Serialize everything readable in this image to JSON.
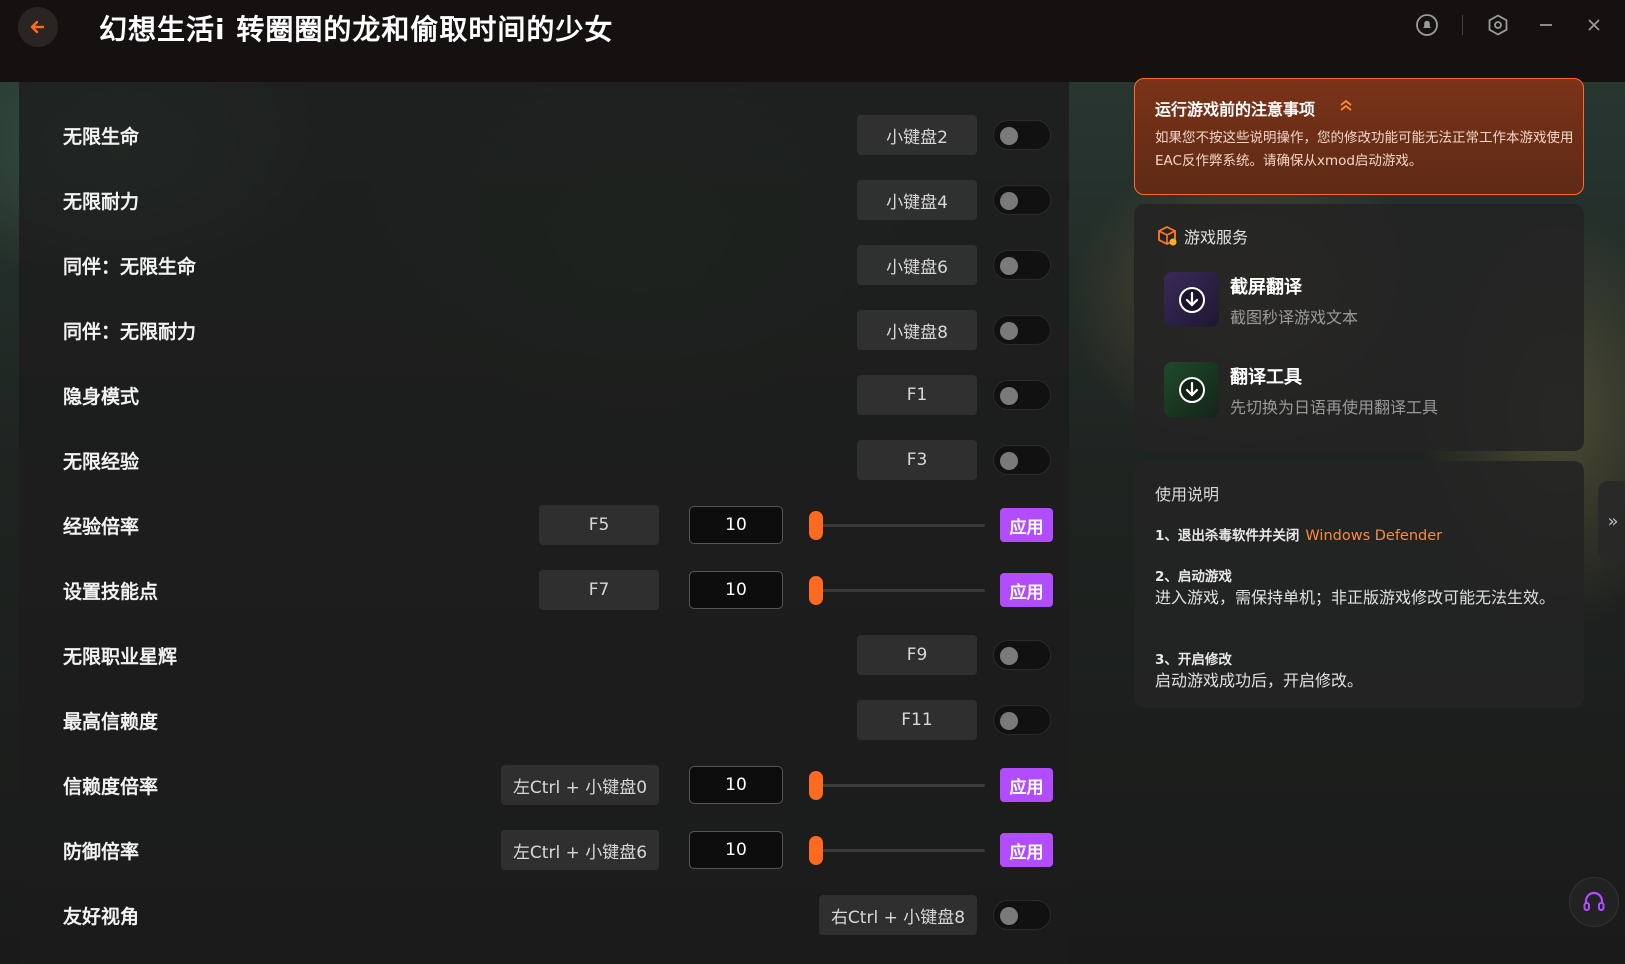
{
  "app": {
    "title": "幻想生活i 转圈圈的龙和偷取时间的少女"
  },
  "rows": [
    {
      "label": "无限生命",
      "key": "小键盘2",
      "type": "toggle"
    },
    {
      "label": "无限耐力",
      "key": "小键盘4",
      "type": "toggle"
    },
    {
      "label": "同伴：无限生命",
      "key": "小键盘6",
      "type": "toggle"
    },
    {
      "label": "同伴：无限耐力",
      "key": "小键盘8",
      "type": "toggle"
    },
    {
      "label": "隐身模式",
      "key": "F1",
      "type": "toggle"
    },
    {
      "label": "无限经验",
      "key": "F3",
      "type": "toggle"
    },
    {
      "label": "经验倍率",
      "key": "F5",
      "type": "slider",
      "value": "10",
      "apply": "应用"
    },
    {
      "label": "设置技能点",
      "key": "F7",
      "type": "slider",
      "value": "10",
      "apply": "应用"
    },
    {
      "label": "无限职业星辉",
      "key": "F9",
      "type": "toggle"
    },
    {
      "label": "最高信赖度",
      "key": "F11",
      "type": "toggle"
    },
    {
      "label": "信赖度倍率",
      "key": "左Ctrl + 小键盘0",
      "type": "slider",
      "value": "10",
      "apply": "应用"
    },
    {
      "label": "防御倍率",
      "key": "左Ctrl + 小键盘6",
      "type": "slider",
      "value": "10",
      "apply": "应用"
    },
    {
      "label": "友好视角",
      "key": "右Ctrl + 小键盘8",
      "type": "toggle"
    }
  ],
  "notice": {
    "title": "运行游戏前的注意事项",
    "text": "如果您不按这些说明操作，您的修改功能可能无法正常工作本游戏使用EAC反作弊系统。请确保从xmod启动游戏。"
  },
  "services": {
    "title": "游戏服务",
    "items": [
      {
        "title": "截屏翻译",
        "subtitle": "截图秒译游戏文本"
      },
      {
        "title": "翻译工具",
        "subtitle": "先切换为日语再使用翻译工具"
      }
    ]
  },
  "howto": {
    "title": "使用说明",
    "steps": [
      {
        "head": "1、退出杀毒软件并关闭",
        "link": "Windows Defender",
        "body": ""
      },
      {
        "head": "2、启动游戏",
        "body": "进入游戏，需保持单机；非正版游戏修改可能无法生效。"
      },
      {
        "head": "3、开启修改",
        "body": "启动游戏成功后，开启修改。"
      }
    ]
  },
  "colors": {
    "accent_orange": "#ff6a1f",
    "apply_purple": "#b14cff",
    "notice_border": "#ff6a2a"
  },
  "icons": {
    "back": "arrow-left-icon",
    "notify": "bell-icon",
    "settings": "hex-gear-icon",
    "minimize": "minimize-icon",
    "close": "close-icon",
    "services": "game-box-icon",
    "download": "download-circle-icon",
    "support": "headset-icon",
    "expand": "double-chevron-right-icon"
  }
}
